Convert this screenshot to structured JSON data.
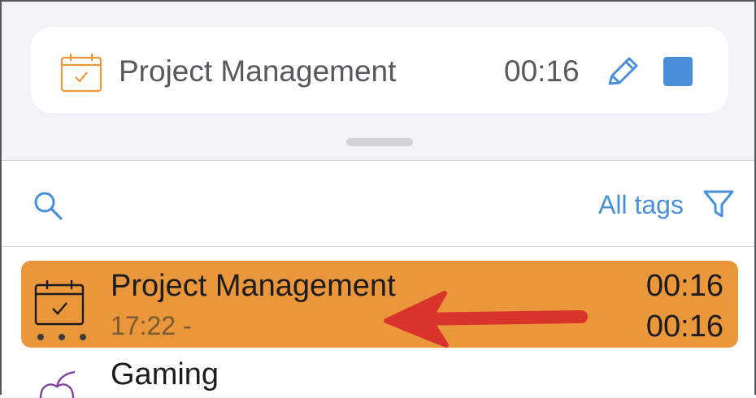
{
  "running_timer": {
    "icon": "calendar-check-icon",
    "title": "Project Management",
    "elapsed": "00:16",
    "edit_icon": "pencil-icon",
    "stop_icon": "stop-square-icon",
    "accent": "#4a90d9",
    "icon_color": "#ea963b"
  },
  "toolbar": {
    "search_icon": "search-icon",
    "tags_label": "All tags",
    "filter_icon": "funnel-icon"
  },
  "entries": [
    {
      "icon": "calendar-check-icon",
      "title": "Project Management",
      "start": "17:22 -",
      "duration": "00:16",
      "total": "00:16",
      "color": "#ea963b"
    },
    {
      "icon": "apple-icon",
      "title": "Gaming",
      "color": "#7b3fa0"
    }
  ],
  "annotation": {
    "icon": "red-arrow-icon",
    "color": "#d9342b"
  }
}
